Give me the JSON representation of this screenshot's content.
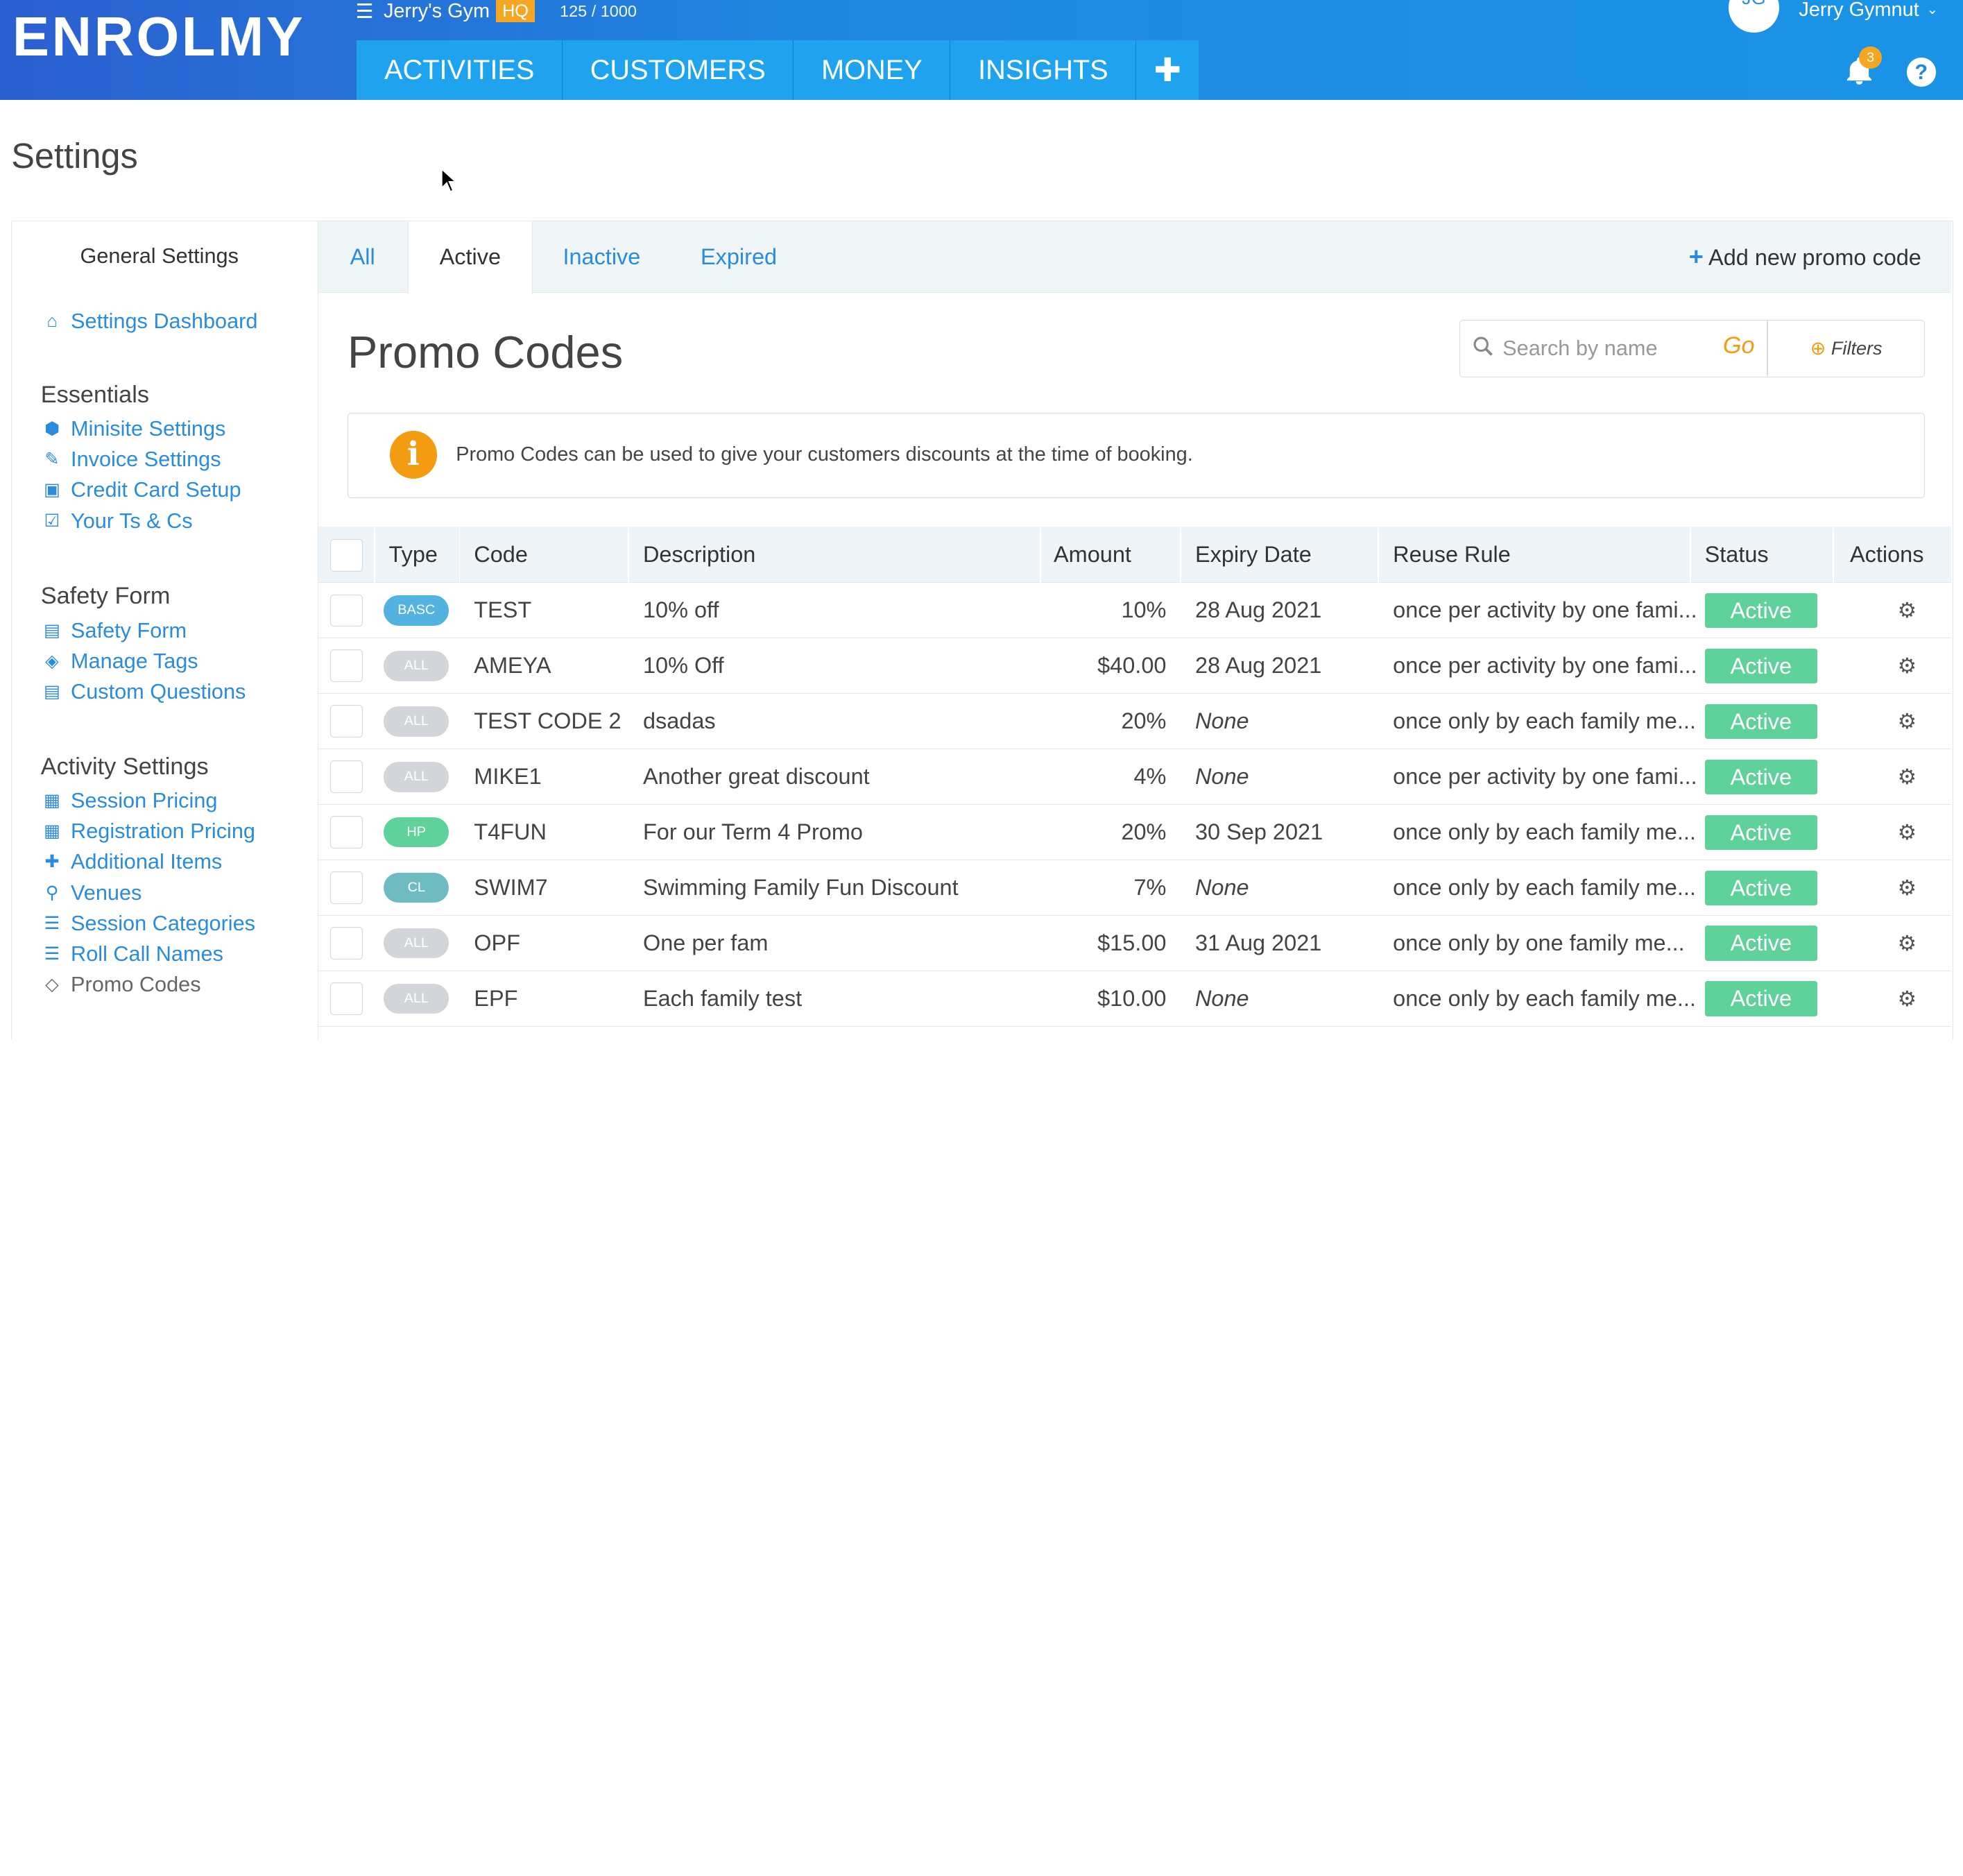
{
  "header": {
    "logo": "ENROLMY",
    "gym_name": "Jerry's Gym",
    "hq_badge": "HQ",
    "quota": "125 / 1000",
    "nav": [
      "ACTIVITIES",
      "CUSTOMERS",
      "MONEY",
      "INSIGHTS"
    ],
    "nav_plus": "✚",
    "user_initials": "JG",
    "user_name": "Jerry Gymnut",
    "notification_count": "3",
    "help": "?"
  },
  "page_title": "Settings",
  "sidebar": {
    "heading": "General Settings",
    "dashboard": "Settings Dashboard",
    "groups": [
      {
        "title": "Essentials",
        "items": [
          "Minisite Settings",
          "Invoice Settings",
          "Credit Card Setup",
          "Your Ts & Cs"
        ]
      },
      {
        "title": "Safety Form",
        "items": [
          "Safety Form",
          "Manage Tags",
          "Custom Questions"
        ]
      },
      {
        "title": "Activity Settings",
        "items": [
          "Session Pricing",
          "Registration Pricing",
          "Additional Items",
          "Venues",
          "Session Categories",
          "Roll Call Names",
          "Promo Codes"
        ]
      }
    ],
    "icons": {
      "dashboard": "home-icon",
      "Minisite Settings": "cube-icon",
      "Invoice Settings": "pencil-icon",
      "Credit Card Setup": "money-icon",
      "Your Ts & Cs": "check-square-icon",
      "Safety Form": "file-icon",
      "Manage Tags": "tags-icon",
      "Custom Questions": "file-icon",
      "Session Pricing": "briefcase-icon",
      "Registration Pricing": "briefcase-icon",
      "Additional Items": "puzzle-icon",
      "Venues": "map-marker-icon",
      "Session Categories": "list-icon",
      "Roll Call Names": "list-icon",
      "Promo Codes": "ticket-icon"
    }
  },
  "tabs": [
    "All",
    "Active",
    "Inactive",
    "Expired"
  ],
  "active_tab": "Active",
  "add_promo_label": "Add new promo code",
  "promo_title": "Promo Codes",
  "search": {
    "placeholder": "Search by name",
    "go_label": "Go",
    "filters_label": "Filters"
  },
  "info_text": "Promo Codes can be used to give your customers discounts at the time of booking.",
  "table": {
    "headers": [
      "Type",
      "Code",
      "Description",
      "Amount",
      "Expiry Date",
      "Reuse Rule",
      "Status",
      "Actions"
    ],
    "rows": [
      {
        "type": "BASC",
        "type_color": "#52b3e0",
        "code": "TEST",
        "description": "10% off",
        "amount": "10%",
        "expiry": "28 Aug 2021",
        "reuse": "once per activity by one fami...",
        "status": "Active"
      },
      {
        "type": "ALL",
        "type_color": "#d2d6da",
        "code": "AMEYA",
        "description": "10% Off",
        "amount": "$40.00",
        "expiry": "28 Aug 2021",
        "reuse": "once per activity by one fami...",
        "status": "Active"
      },
      {
        "type": "ALL",
        "type_color": "#d2d6da",
        "code": "TEST CODE 2",
        "description": "dsadas",
        "amount": "20%",
        "expiry": "None",
        "reuse": "once only by each family me...",
        "status": "Active"
      },
      {
        "type": "ALL",
        "type_color": "#d2d6da",
        "code": "MIKE1",
        "description": "Another great discount",
        "amount": "4%",
        "expiry": "None",
        "reuse": "once per activity by one fami...",
        "status": "Active"
      },
      {
        "type": "HP",
        "type_color": "#5fd19a",
        "code": "T4FUN",
        "description": "For our Term 4 Promo",
        "amount": "20%",
        "expiry": "30 Sep 2021",
        "reuse": "once only by each family me...",
        "status": "Active"
      },
      {
        "type": "CL",
        "type_color": "#6fbcc0",
        "code": "SWIM7",
        "description": "Swimming Family Fun Discount",
        "amount": "7%",
        "expiry": "None",
        "reuse": "once only by each family me...",
        "status": "Active"
      },
      {
        "type": "ALL",
        "type_color": "#d2d6da",
        "code": "OPF",
        "description": "One per fam",
        "amount": "$15.00",
        "expiry": "31 Aug 2021",
        "reuse": "once only by one family me...",
        "status": "Active"
      },
      {
        "type": "ALL",
        "type_color": "#d2d6da",
        "code": "EPF",
        "description": "Each family test",
        "amount": "$10.00",
        "expiry": "None",
        "reuse": "once only by each family me...",
        "status": "Active"
      }
    ]
  },
  "colors": {
    "brand_blue": "#1f86e0",
    "nav_tab": "#1fa3ee",
    "link": "#2b8bdc",
    "accent_orange": "#f39c12",
    "status_green": "#5fd19a"
  }
}
